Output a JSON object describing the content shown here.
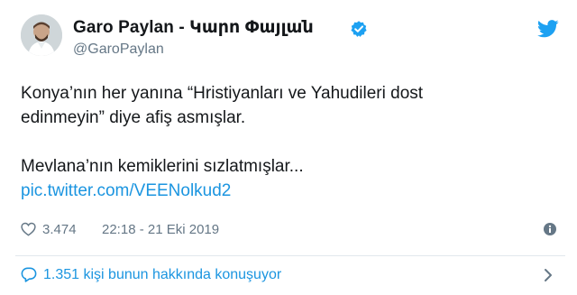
{
  "author": {
    "display_name": "Garo Paylan - Կարո Փայլան",
    "handle": "@GaroPaylan"
  },
  "tweet": {
    "lines": [
      "Konya’nın her yanına “Hristiyanları ve Yahudileri dost",
      "edinmeyin” diye afiş asmışlar.",
      "Mevlana’nın kemiklerini sızlatmışlar..."
    ],
    "link": "pic.twitter.com/VEENolkud2"
  },
  "meta": {
    "like_count": "3.474",
    "timestamp": "22:18 - 21 Eki 2019"
  },
  "conversation": {
    "text": "1.351 kişi bunun hakkında konuşuyor"
  },
  "colors": {
    "link_blue": "#1b95e0",
    "text_dark": "#14171a",
    "text_gray": "#657786",
    "verified_blue": "#1da1f2",
    "divider": "#e1e8ed"
  },
  "icons": [
    "verified-badge-icon",
    "twitter-bird-icon",
    "heart-icon",
    "info-icon",
    "reply-bubble-icon",
    "chevron-right-icon"
  ]
}
